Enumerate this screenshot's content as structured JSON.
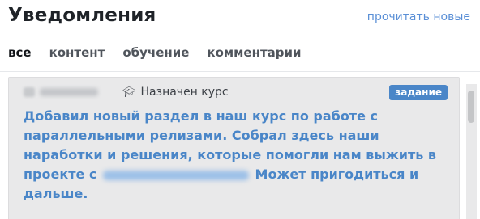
{
  "header": {
    "title": "Уведомления",
    "mark_read_label": "прочитать новые"
  },
  "tabs": [
    {
      "label": "все",
      "active": true
    },
    {
      "label": "контент",
      "active": false
    },
    {
      "label": "обучение",
      "active": false
    },
    {
      "label": "комментарии",
      "active": false
    }
  ],
  "notification": {
    "event_icon": "graduation-cap-icon",
    "event_type": "Назначен курс",
    "badge": "задание",
    "text_part1": "Добавил новый раздел в наш курс по работе с параллельными релизами. Собрал здесь наши наработки и решения, которые помогли нам выжить в проекте с",
    "text_part2": "Может пригодиться и дальше."
  },
  "colors": {
    "accent": "#4a86c8",
    "card_bg": "#e9e9ea"
  }
}
